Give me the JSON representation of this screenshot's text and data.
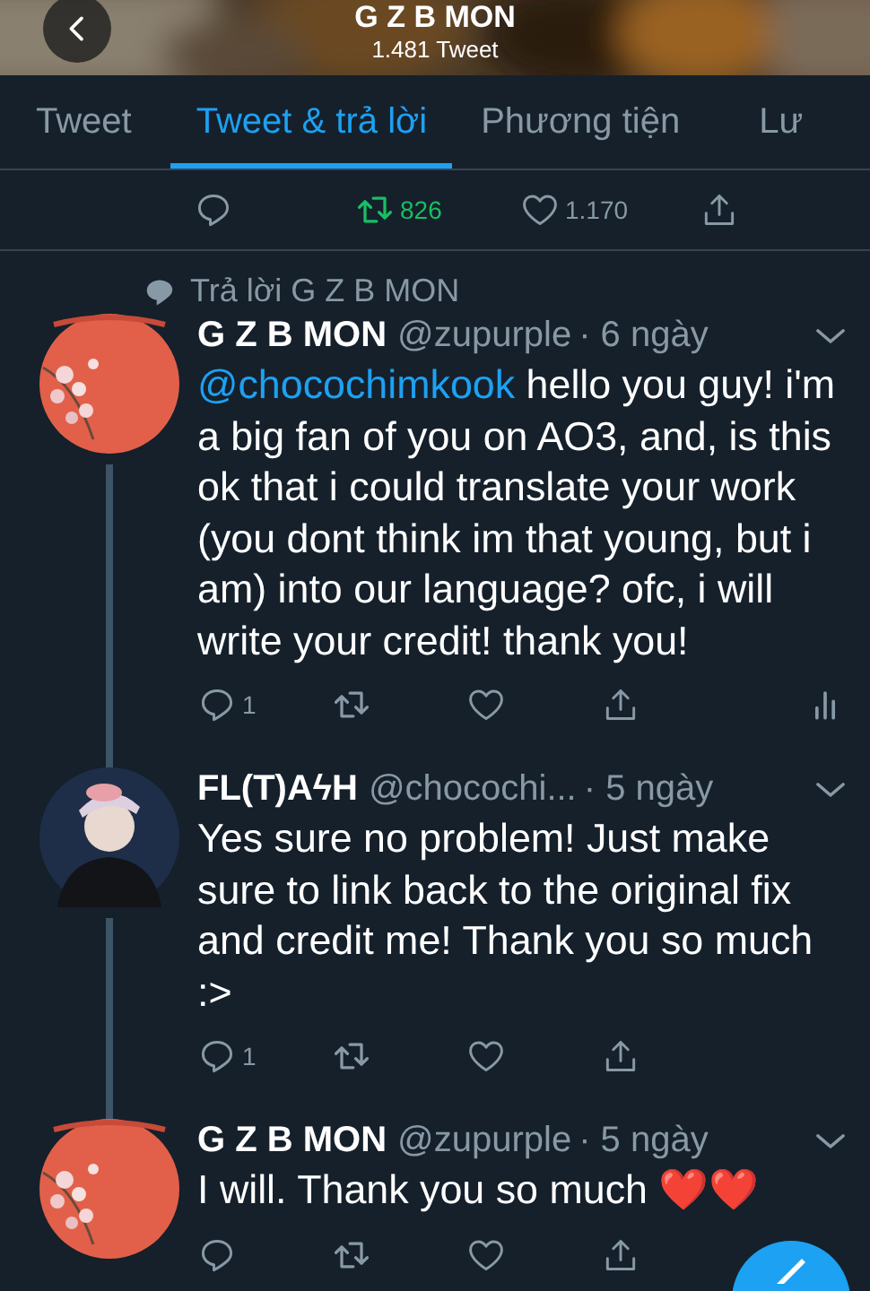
{
  "header": {
    "title": "G Z B MON",
    "subtitle": "1.481 Tweet"
  },
  "tabs": [
    {
      "label": "Tweet",
      "selected": false
    },
    {
      "label": "Tweet & trả lời",
      "selected": true
    },
    {
      "label": "Phương tiện",
      "selected": false
    },
    {
      "label": "Lư",
      "selected": false
    }
  ],
  "top_actions": {
    "retweet_count": "826",
    "retweeted": true,
    "like_count": "1.170"
  },
  "reply_context": "Trả lời G Z B MON",
  "tweets": [
    {
      "name": "G Z B MON",
      "handle": "@zupurple",
      "time": "· 6 ngày",
      "mention": "@chocochimkook",
      "text": " hello you guy! i'm a big fan of you on AO3,  and, is this ok that i could translate your work (you dont think im that young, but i am) into our language? ofc, i will write your credit! thank you!",
      "reply_count": "1",
      "analytics": true,
      "thread_line": true
    },
    {
      "name": "FL(T)AϟH",
      "handle": "@chocochi...",
      "time": "· 5 ngày",
      "text": "Yes sure no problem! Just make sure to link back to the original fix and credit me! Thank you so much :>",
      "reply_count": "1",
      "analytics": false,
      "thread_line": true
    },
    {
      "name": "G Z B MON",
      "handle": "@zupurple",
      "time": "· 5 ngày",
      "text": "I will. Thank you so much ❤️❤️",
      "analytics": false,
      "thread_line": false
    }
  ]
}
